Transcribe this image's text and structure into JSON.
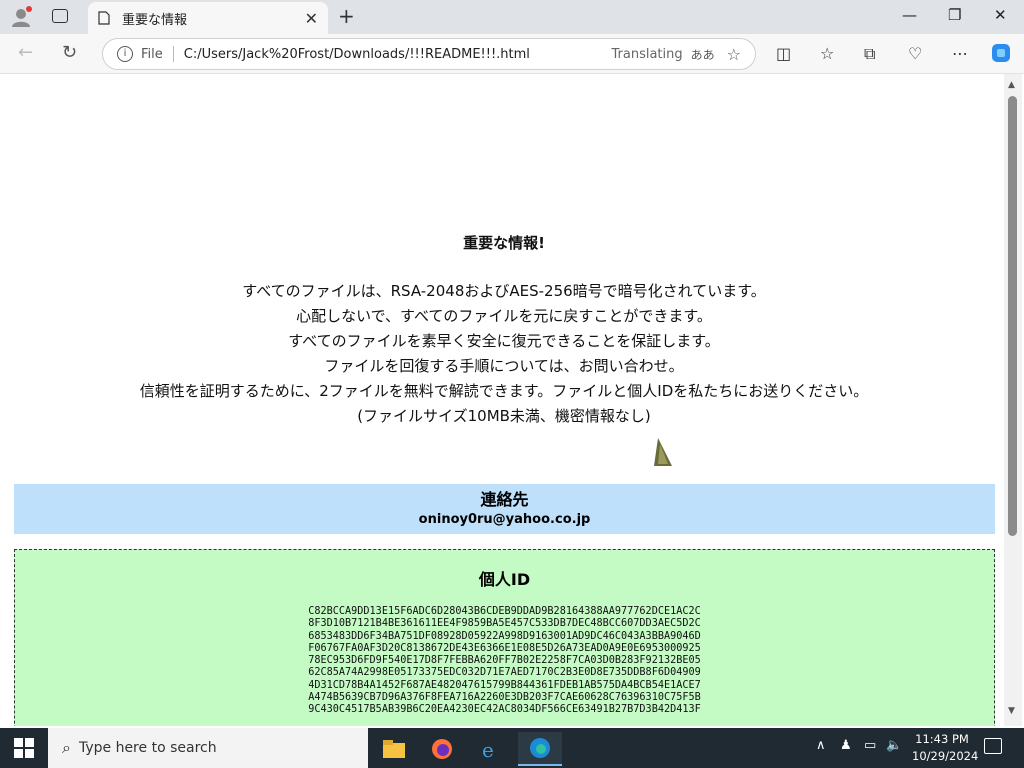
{
  "browser": {
    "tab_title": "重要な情報",
    "address_file_label": "File",
    "address_url": "C:/Users/Jack%20Frost/Downloads/!!!README!!!.html",
    "translating_label": "Translating",
    "translate_icon_text": "ああ"
  },
  "page": {
    "heading": "重要な情報!",
    "lines": [
      "すべてのファイルは、RSA-2048およびAES-256暗号で暗号化されています。",
      "心配しないで、すべてのファイルを元に戻すことができます。",
      "すべてのファイルを素早く安全に復元できることを保証します。",
      "ファイルを回復する手順については、お問い合わせ。",
      "信頼性を証明するために、2ファイルを無料で解読できます。ファイルと個人IDを私たちにお送りください。",
      "(ファイルサイズ10MB未満、機密情報なし)"
    ],
    "contact_title": "連絡先",
    "contact_email": "oninoy0ru@yahoo.co.jp",
    "id_title": "個人ID",
    "id_text": "C82BCCA9DD13E15F6ADC6D28043B6CDEB9DDAD9B28164388AA977762DCE1AC2C\n8F3D10B7121B4BE361611EE4F9859BA5E457C533DB7DEC48BCC607DD3AEC5D2C\n6853483DD6F34BA751DF08928D05922A998D9163001AD9DC46C043A3BBA9046D\nF06767FA0AF3D20C8138672DE43E6366E1E08E5D26A73EAD0A9E0E6953000925\n78EC953D6FD9F540E17D8F7FEBBA620FF7B02E2258F7CA03D0B283F92132BE05\n62C85A74A2998E05173375EDC032D71E7AED7170C2B3E0D8E735DDB8F6D04909\n4D31CD78B4A1452F687AE482047615799B844361FDEB1AB575DA4BCB54E1ACE7\nA474B5639CB7D96A376F8FEA716A2260E3DB203F7CAE60628C76396310C75F5B\n9C430C4517B5AB39B6C20EA4230EC42AC8034DF566CE63491B27B7D3B42D413F"
  },
  "taskbar": {
    "search_placeholder": "Type here to search",
    "time": "11:43 PM",
    "date": "10/29/2024"
  },
  "colors": {
    "contact_bg": "#bfe0fb",
    "id_bg": "#c4fac4"
  }
}
